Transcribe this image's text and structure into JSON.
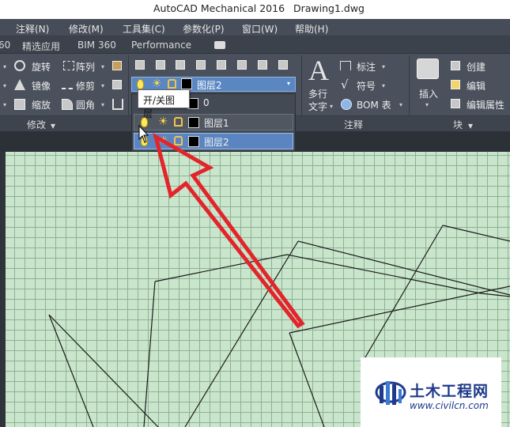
{
  "title_bar": {
    "app": "AutoCAD Mechanical 2016",
    "document": "Drawing1.dwg"
  },
  "menu": {
    "items": [
      "注释(N)",
      "修改(M)",
      "工具集(C)",
      "参数化(P)",
      "窗口(W)",
      "帮助(H)"
    ]
  },
  "ribbon_tabs": {
    "items": [
      "60",
      "精选应用",
      "BIM 360",
      "Performance"
    ]
  },
  "modify_panel": {
    "rotate": "旋转",
    "array": "阵列",
    "mirror": "镜像",
    "trim": "修剪",
    "scale": "缩放",
    "fillet": "圆角",
    "panel_label": "修改"
  },
  "annotation_panel": {
    "multiline_text_line1": "多行",
    "multiline_text_line2": "文字",
    "dimension": "标注",
    "symbol": "符号",
    "bom": "BOM 表",
    "panel_label": "注释"
  },
  "block_panel": {
    "insert": "插入",
    "create": "创建",
    "edit": "编辑",
    "edit_attributes": "编辑属性",
    "panel_label": "块"
  },
  "layer_combo": {
    "current": "图层2"
  },
  "layer_list": {
    "rows": [
      "0",
      "图层1",
      "图层2"
    ]
  },
  "tooltip": {
    "text": "开/关图层"
  },
  "watermark": {
    "title": "土木工程网",
    "url": "www.civilcn.com"
  },
  "colors": {
    "drawing_bg": "#c9e6cc",
    "grid": "#8fb096",
    "ribbon": "#4a515c",
    "highlight": "#5b85c0",
    "arrow": "#e3242b"
  }
}
